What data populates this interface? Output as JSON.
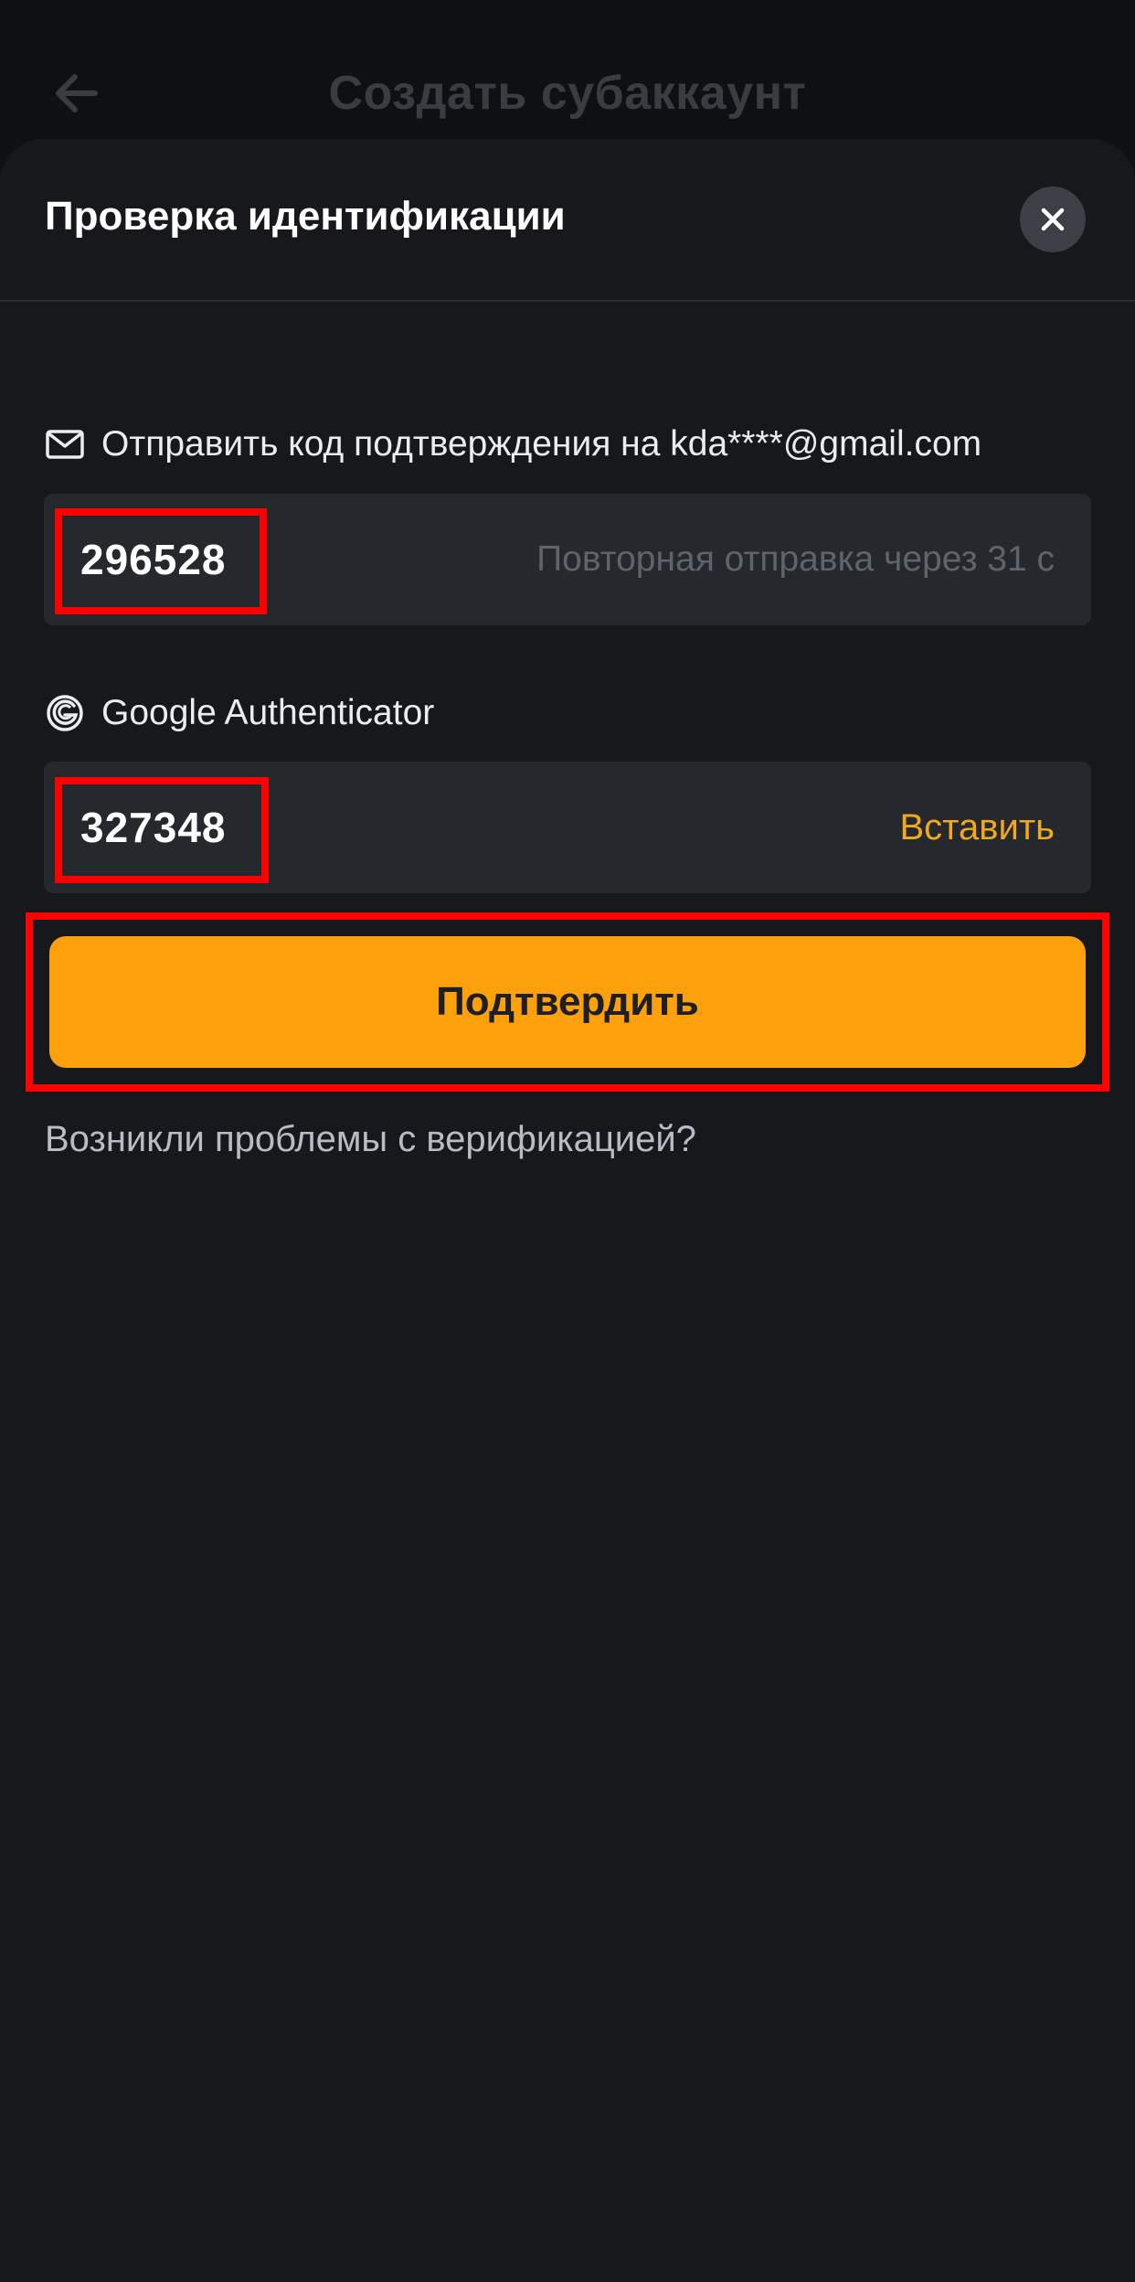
{
  "background_page": {
    "title": "Создать субаккаунт"
  },
  "sheet": {
    "title": "Проверка идентификации"
  },
  "email_field": {
    "label": "Отправить код подтверждения на kda****@gmail.com",
    "icon": "mail-icon",
    "value": "296528",
    "resend_text": "Повторная отправка через 31 с"
  },
  "google_auth_field": {
    "label": "Google Authenticator",
    "icon": "google-authenticator-icon",
    "value": "327348",
    "paste_label": "Вставить"
  },
  "confirm_button": {
    "label": "Подтвердить"
  },
  "help_link": {
    "label": "Возникли проблемы с верификацией?"
  },
  "colors": {
    "accent": "#fca10c",
    "link": "#f0a81c",
    "highlight": "#ff0000",
    "background": "#17181c",
    "input_bg": "#25282d"
  }
}
